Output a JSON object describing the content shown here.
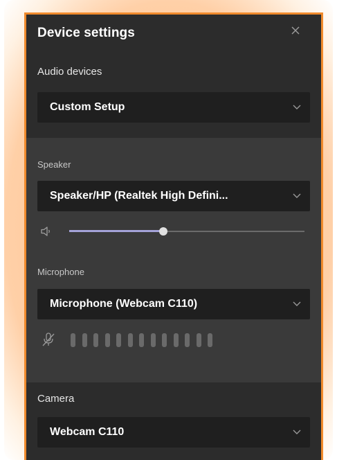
{
  "dialog": {
    "title": "Device settings"
  },
  "audio": {
    "label": "Audio devices",
    "selected": "Custom Setup"
  },
  "speaker": {
    "label": "Speaker",
    "selected": "Speaker/HP (Realtek High Defini...",
    "volume": 0.4
  },
  "microphone": {
    "label": "Microphone",
    "selected": "Microphone (Webcam C110)",
    "muted": true,
    "meter_segments": 13,
    "meter_level": 0
  },
  "camera": {
    "label": "Camera",
    "selected": "Webcam C110"
  },
  "icons": {
    "close": "close-icon",
    "chevron": "chevron-down-icon",
    "volume": "speaker-volume-icon",
    "mic_muted": "microphone-muted-icon"
  },
  "colors": {
    "accent_border": "#f08a2c",
    "slider_fill": "#a4a3d8",
    "panel_bg": "#2b2b2b"
  }
}
